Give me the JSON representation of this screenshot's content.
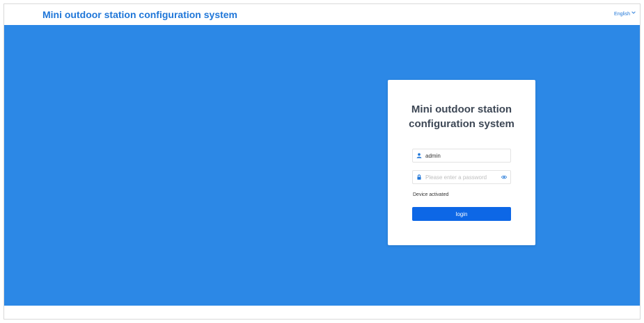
{
  "header": {
    "title": "Mini outdoor station configuration system",
    "language": "English"
  },
  "login": {
    "title_line1": "Mini outdoor station",
    "title_line2": "configuration system",
    "username_value": "admin",
    "password_placeholder": "Please enter a password",
    "status_text": "Device activated",
    "login_label": "login"
  },
  "colors": {
    "accent": "#1f76d8",
    "banner": "#2c88e6",
    "button": "#0d67e6"
  },
  "icons": {
    "user": "user-icon",
    "lock": "lock-icon",
    "eye": "eye-icon",
    "chevron": "chevron-down-icon"
  }
}
